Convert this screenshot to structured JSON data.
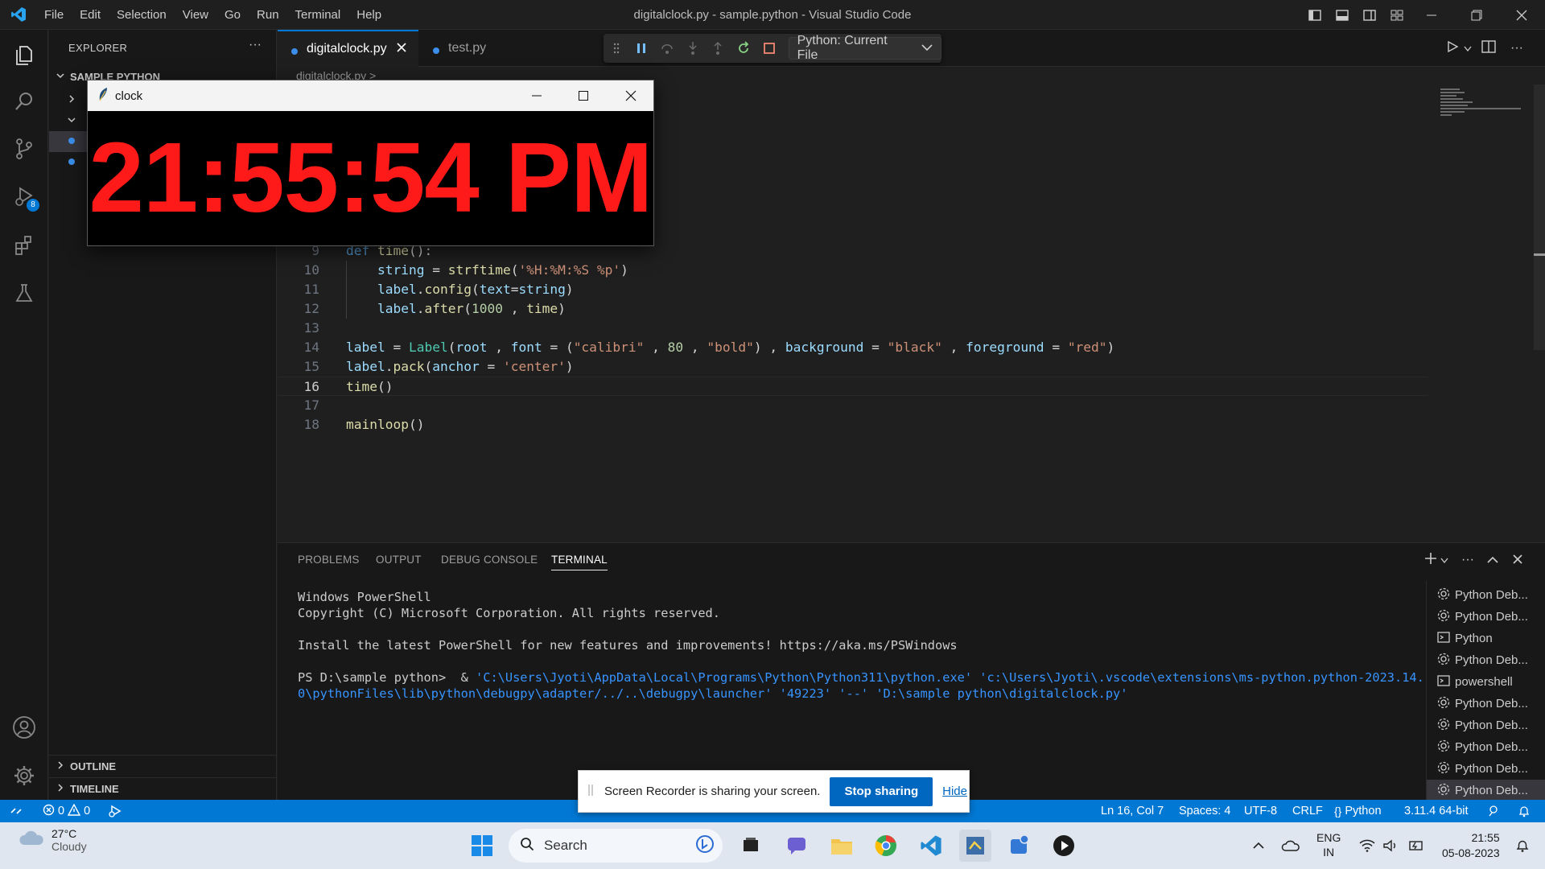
{
  "window": {
    "title": "digitalclock.py - sample.python - Visual Studio Code"
  },
  "menu": [
    "File",
    "Edit",
    "Selection",
    "View",
    "Go",
    "Run",
    "Terminal",
    "Help"
  ],
  "activity_bar": {
    "run_debug_badge": "8"
  },
  "sidebar": {
    "header": "EXPLORER",
    "more": "···",
    "project": "SAMPLE PYTHON",
    "sections": {
      "outline": "OUTLINE",
      "timeline": "TIMELINE"
    }
  },
  "tabs": [
    {
      "label": "digitalclock.py",
      "active": true
    },
    {
      "label": "test.py",
      "active": false
    }
  ],
  "debug_toolbar": {
    "config": "Python: Current File"
  },
  "breadcrumb": "digitalclock.py >",
  "editor": {
    "lines": [
      {
        "num": "9",
        "text": "def time():"
      },
      {
        "num": "10",
        "text": "    string = strftime('%H:%M:%S %p')"
      },
      {
        "num": "11",
        "text": "    label.config(text=string)"
      },
      {
        "num": "12",
        "text": "    label.after(1000 , time)"
      },
      {
        "num": "13",
        "text": ""
      },
      {
        "num": "14",
        "text": "label = Label(root , font = (\"calibri\" , 80 , \"bold\") , background = \"black\" , foreground = \"red\")"
      },
      {
        "num": "15",
        "text": "label.pack(anchor = 'center')"
      },
      {
        "num": "16",
        "text": "time()"
      },
      {
        "num": "17",
        "text": ""
      },
      {
        "num": "18",
        "text": "mainloop()"
      }
    ],
    "current_line": "16"
  },
  "panel": {
    "tabs": [
      "PROBLEMS",
      "OUTPUT",
      "DEBUG CONSOLE",
      "TERMINAL"
    ],
    "active_tab": "TERMINAL",
    "terminal": {
      "line1": "Windows PowerShell",
      "line2": "Copyright (C) Microsoft Corporation. All rights reserved.",
      "line3": "Install the latest PowerShell for new features and improvements! https://aka.ms/PSWindows",
      "prompt": "PS D:\\sample python>  & ",
      "cmd1": "'C:\\Users\\Jyoti\\AppData\\Local\\Programs\\Python\\Python311\\python.exe' 'c:\\Users\\Jyoti\\.vscode\\extensions\\ms-python.python-2023.14.",
      "cmd2": "0\\pythonFiles\\lib\\python\\debugpy\\adapter/../..\\debugpy\\launcher' '49223' '--' 'D:\\sample python\\digitalclock.py'"
    },
    "terminal_list": [
      {
        "label": "Python Deb...",
        "icon": "debug-gear"
      },
      {
        "label": "Python Deb...",
        "icon": "debug-gear"
      },
      {
        "label": "Python",
        "icon": "terminal"
      },
      {
        "label": "Python Deb...",
        "icon": "debug-gear"
      },
      {
        "label": "powershell",
        "icon": "terminal"
      },
      {
        "label": "Python Deb...",
        "icon": "debug-gear"
      },
      {
        "label": "Python Deb...",
        "icon": "debug-gear"
      },
      {
        "label": "Python Deb...",
        "icon": "debug-gear"
      },
      {
        "label": "Python Deb...",
        "icon": "debug-gear"
      },
      {
        "label": "Python Deb...",
        "icon": "debug-gear"
      }
    ]
  },
  "statusbar": {
    "errors": "0",
    "warnings": "0",
    "position": "Ln 16, Col 7",
    "spaces": "Spaces: 4",
    "encoding": "UTF-8",
    "eol": "CRLF",
    "language": "Python",
    "interpreter": "3.11.4 64-bit"
  },
  "share_banner": {
    "text": "Screen Recorder is sharing your screen.",
    "stop": "Stop sharing",
    "hide": "Hide"
  },
  "clock_window": {
    "title": "clock",
    "time": "21:55:54 PM"
  },
  "taskbar": {
    "weather_temp": "27°C",
    "weather_desc": "Cloudy",
    "search": "Search",
    "lang1": "ENG",
    "lang2": "IN",
    "time": "21:55",
    "date": "05-08-2023"
  },
  "colors": {
    "accent": "#0078d4",
    "clock_fg": "#ff1a1a",
    "clock_bg": "#000000"
  }
}
